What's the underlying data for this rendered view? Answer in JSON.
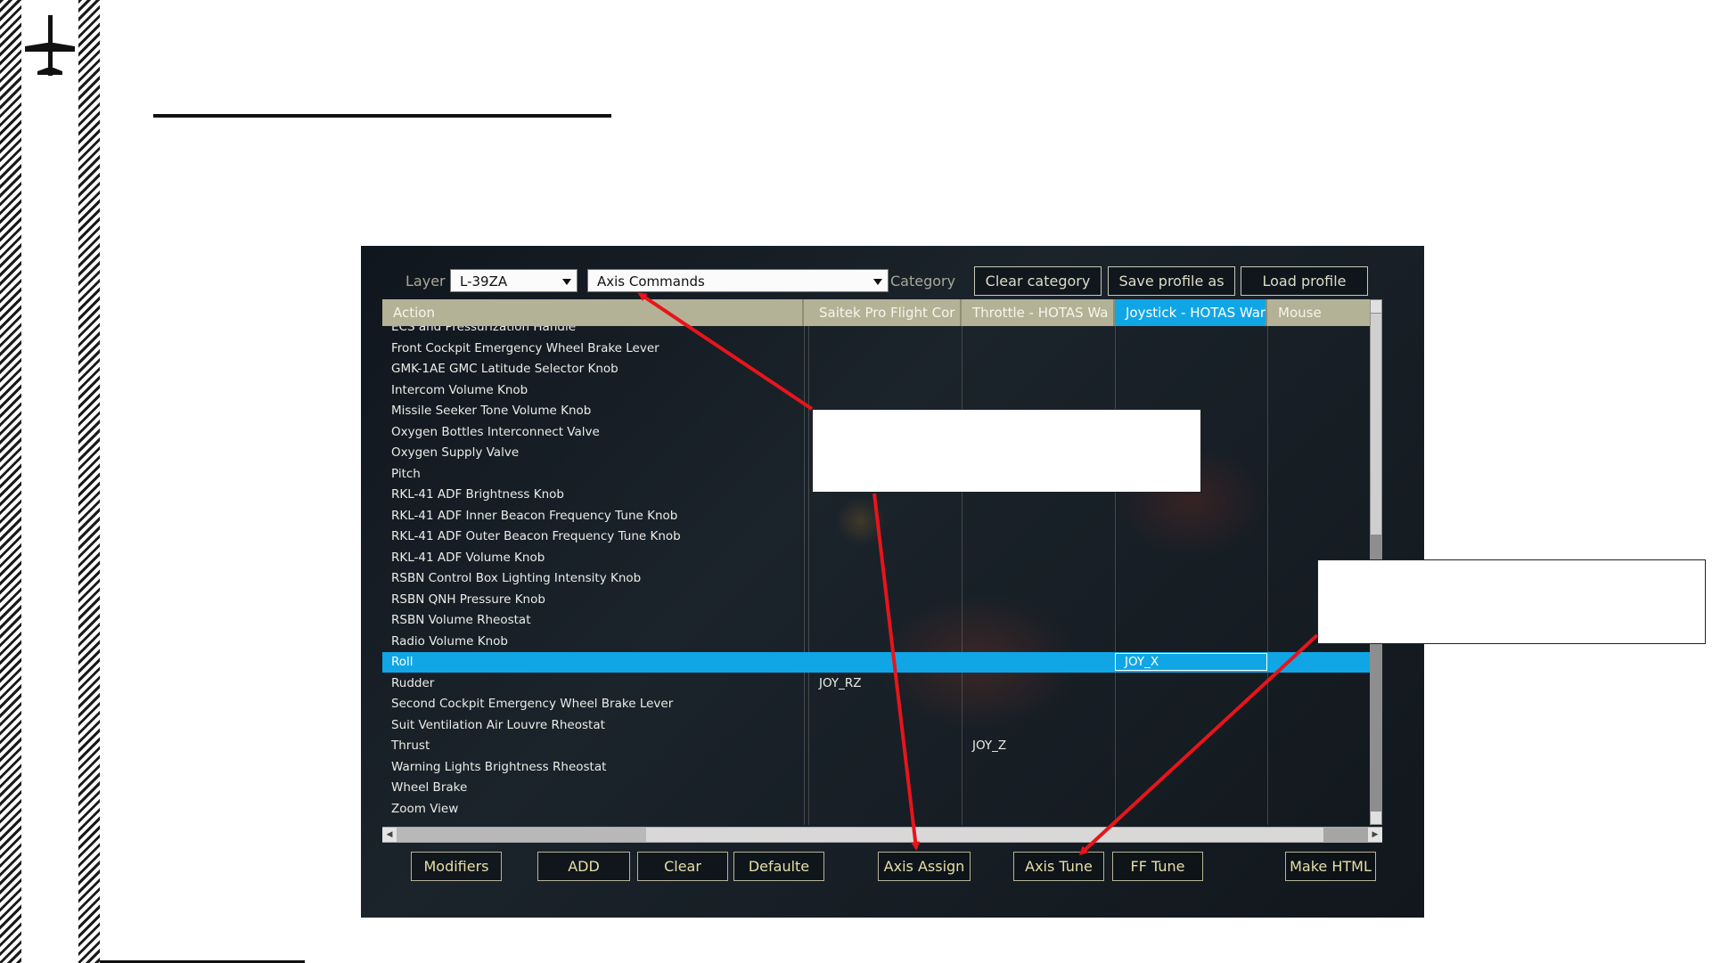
{
  "slide": {
    "logo_icon": "airplane-silhouette-icon"
  },
  "toolbar": {
    "layer_label": "Layer",
    "layer_value": "L-39ZA",
    "mode_value": "Axis Commands",
    "category_label": "Category",
    "clear_category": "Clear category",
    "save_profile": "Save profile as",
    "load_profile": "Load profile"
  },
  "table": {
    "headers": [
      "Action",
      "Saitek Pro Flight Cor",
      "Throttle - HOTAS Wa",
      "Joystick - HOTAS War",
      "Mouse"
    ],
    "active_header_index": 3,
    "rows": [
      {
        "action": "ECS and Pressurization Handle",
        "saitek": "",
        "throttle": "",
        "joystick": "",
        "mouse": ""
      },
      {
        "action": "Front Cockpit Emergency Wheel Brake Lever",
        "saitek": "",
        "throttle": "",
        "joystick": "",
        "mouse": ""
      },
      {
        "action": "GMK-1AE GMC Latitude Selector Knob",
        "saitek": "",
        "throttle": "",
        "joystick": "",
        "mouse": ""
      },
      {
        "action": "Intercom Volume Knob",
        "saitek": "",
        "throttle": "",
        "joystick": "",
        "mouse": ""
      },
      {
        "action": "Missile Seeker Tone Volume Knob",
        "saitek": "",
        "throttle": "",
        "joystick": "",
        "mouse": ""
      },
      {
        "action": "Oxygen Bottles Interconnect Valve",
        "saitek": "",
        "throttle": "",
        "joystick": "",
        "mouse": ""
      },
      {
        "action": "Oxygen Supply Valve",
        "saitek": "",
        "throttle": "",
        "joystick": "",
        "mouse": ""
      },
      {
        "action": "Pitch",
        "saitek": "",
        "throttle": "",
        "joystick": "",
        "mouse": ""
      },
      {
        "action": "RKL-41 ADF Brightness Knob",
        "saitek": "",
        "throttle": "",
        "joystick": "",
        "mouse": ""
      },
      {
        "action": "RKL-41 ADF Inner Beacon Frequency Tune Knob",
        "saitek": "",
        "throttle": "",
        "joystick": "",
        "mouse": ""
      },
      {
        "action": "RKL-41 ADF Outer Beacon Frequency Tune Knob",
        "saitek": "",
        "throttle": "",
        "joystick": "",
        "mouse": ""
      },
      {
        "action": "RKL-41 ADF Volume Knob",
        "saitek": "",
        "throttle": "",
        "joystick": "",
        "mouse": ""
      },
      {
        "action": "RSBN Control Box Lighting Intensity Knob",
        "saitek": "",
        "throttle": "",
        "joystick": "",
        "mouse": ""
      },
      {
        "action": "RSBN QNH Pressure Knob",
        "saitek": "",
        "throttle": "",
        "joystick": "",
        "mouse": ""
      },
      {
        "action": "RSBN Volume Rheostat",
        "saitek": "",
        "throttle": "",
        "joystick": "",
        "mouse": ""
      },
      {
        "action": "Radio Volume Knob",
        "saitek": "",
        "throttle": "",
        "joystick": "",
        "mouse": ""
      },
      {
        "action": "Roll",
        "saitek": "",
        "throttle": "",
        "joystick": "JOY_X",
        "mouse": "",
        "selected": true
      },
      {
        "action": "Rudder",
        "saitek": "JOY_RZ",
        "throttle": "",
        "joystick": "",
        "mouse": ""
      },
      {
        "action": "Second Cockpit Emergency Wheel Brake Lever",
        "saitek": "",
        "throttle": "",
        "joystick": "",
        "mouse": ""
      },
      {
        "action": "Suit Ventilation Air Louvre Rheostat",
        "saitek": "",
        "throttle": "",
        "joystick": "",
        "mouse": ""
      },
      {
        "action": "Thrust",
        "saitek": "",
        "throttle": "JOY_Z",
        "joystick": "",
        "mouse": ""
      },
      {
        "action": "Warning Lights Brightness Rheostat",
        "saitek": "",
        "throttle": "",
        "joystick": "",
        "mouse": ""
      },
      {
        "action": "Wheel Brake",
        "saitek": "",
        "throttle": "",
        "joystick": "",
        "mouse": ""
      },
      {
        "action": "Zoom View",
        "saitek": "",
        "throttle": "",
        "joystick": "",
        "mouse": ""
      }
    ]
  },
  "bottom_buttons": {
    "modifiers": "Modifiers",
    "add": "ADD",
    "clear": "Clear",
    "defaults": "Defaulte",
    "axis_assign": "Axis Assign",
    "axis_tune": "Axis Tune",
    "ff_tune": "FF Tune",
    "make_html": "Make HTML"
  },
  "colors": {
    "highlight": "#10a6e6",
    "header": "#b4b296",
    "annotation_arrow": "#e8141b"
  }
}
